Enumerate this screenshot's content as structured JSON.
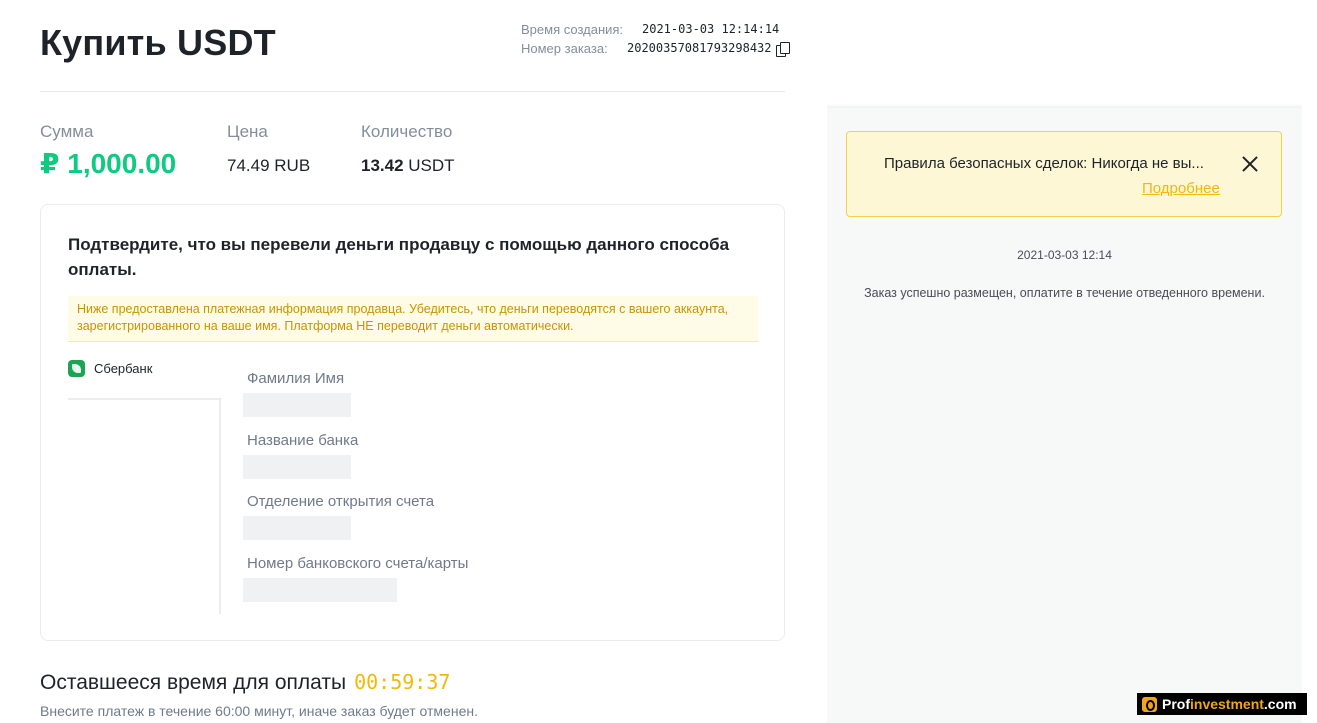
{
  "page": {
    "title": "Купить USDT"
  },
  "meta": {
    "created_label": "Время создания:",
    "created_value": "2021-03-03 12:14:14",
    "order_label": "Номер заказа:",
    "order_value": "20200357081793298432"
  },
  "summary": {
    "sum_label": "Сумма",
    "sum_value": "₽ 1,000.00",
    "price_label": "Цена",
    "price_value": "74.49 RUB",
    "qty_label": "Количество",
    "qty_number": "13.42",
    "qty_unit": "USDT"
  },
  "payment_card": {
    "heading": "Подтвердите, что вы перевели деньги продавцу с помощью данного способа оплаты.",
    "notice": "Ниже предоставлена платежная информация продавца. Убедитесь, что деньги переводятся с вашего аккаунта, зарегистрированного на ваше имя. Платформа НЕ переводит деньги автоматически.",
    "method_name": "Сбербанк",
    "fields": [
      {
        "label": "Фамилия Имя"
      },
      {
        "label": "Название банка"
      },
      {
        "label": "Отделение открытия счета"
      },
      {
        "label": "Номер банковского счета/карты"
      }
    ]
  },
  "timer": {
    "label": "Оставшееся время для оплаты",
    "value": "00:59:37",
    "note": "Внесите платеж в течение 60:00 минут, иначе заказ будет отменен."
  },
  "chat": {
    "banner_text": "Правила безопасных сделок: Никогда не вы...",
    "banner_link": "Подробнее",
    "message_time": "2021-03-03 12:14",
    "message_text": "Заказ успешно размещен, оплатите в течение отведенного времени."
  },
  "watermark": {
    "part1": "Prof",
    "part2": "investment",
    "part3": ".com"
  },
  "colors": {
    "accent_green": "#0ecb81",
    "accent_yellow": "#f0b90b",
    "text_primary": "#1e2329",
    "text_secondary": "#848e9c"
  },
  "icons": [
    "copy-icon",
    "sberbank-icon",
    "close-icon"
  ]
}
